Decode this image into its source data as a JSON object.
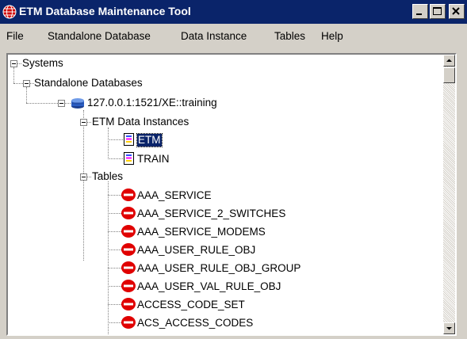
{
  "window": {
    "title": "ETM Database Maintenance Tool"
  },
  "menu": [
    "File",
    "Standalone Database",
    "Data Instance",
    "Tables",
    "Help"
  ],
  "tree": {
    "root": "Systems",
    "standalone": "Standalone Databases",
    "connection": "127.0.0.1:1521/XE::training",
    "instances_label": "ETM Data Instances",
    "instances": [
      "ETM",
      "TRAIN"
    ],
    "selected_instance": "ETM",
    "tables_label": "Tables",
    "tables": [
      "AAA_SERVICE",
      "AAA_SERVICE_2_SWITCHES",
      "AAA_SERVICE_MODEMS",
      "AAA_USER_RULE_OBJ",
      "AAA_USER_RULE_OBJ_GROUP",
      "AAA_USER_VAL_RULE_OBJ",
      "ACCESS_CODE_SET",
      "ACS_ACCESS_CODES"
    ]
  },
  "icons": {
    "app": "globe-icon",
    "database": "database-icon",
    "instance": "document-icon",
    "table": "no-entry-icon"
  },
  "colors": {
    "titlebar": "#0a246a",
    "table_icon": "#e00000",
    "selection": "#0a246a"
  }
}
